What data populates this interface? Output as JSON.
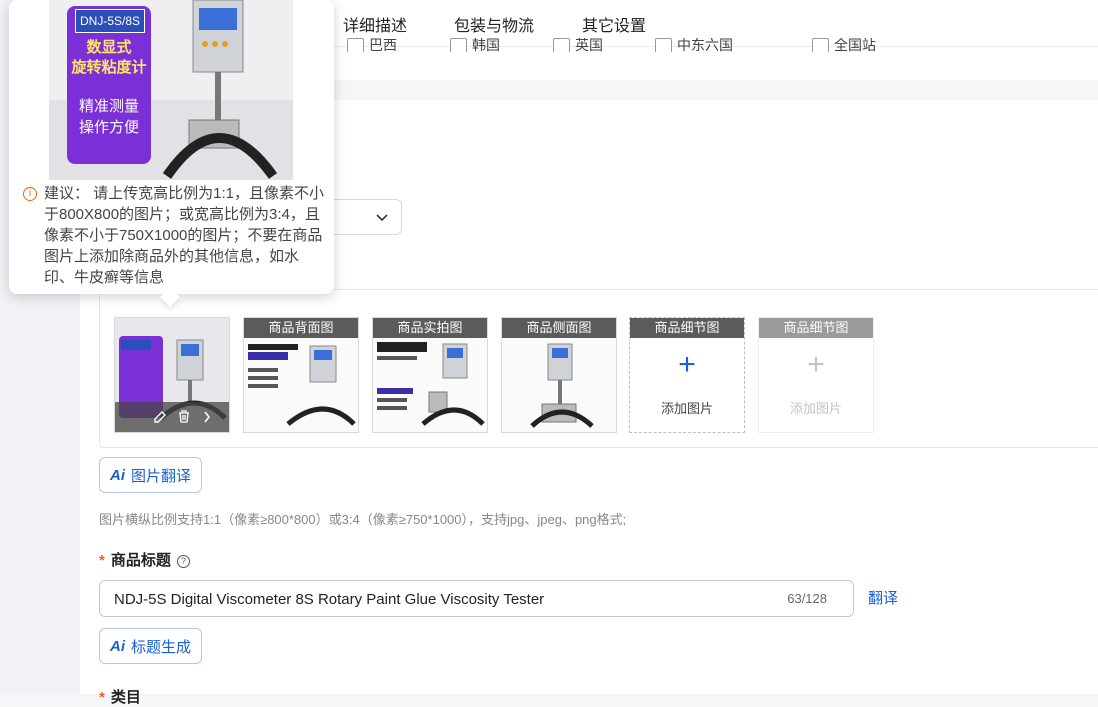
{
  "tabs": [
    {
      "label": "详细描述"
    },
    {
      "label": "包装与物流"
    },
    {
      "label": "其它设置"
    }
  ],
  "checkbox_partial_labels": [
    "巴西",
    "韩国",
    "英国",
    "中东六国",
    "全国站"
  ],
  "tooltip": {
    "image": {
      "model_badge": "DNJ-5S/8S",
      "headline_1": "数显式",
      "headline_2": "旋转粘度计",
      "tagline_1": "精准测量",
      "tagline_2": "操作方便"
    },
    "suggestion": "建议： 请上传宽高比例为1:1，且像素不小于800X800的图片；或宽高比例为3:4，且像素不小于750X1000的图片；不要在商品图片上添加除商品外的其他信息，如水印、牛皮癣等信息"
  },
  "images": [
    {
      "header": "",
      "kind": "main"
    },
    {
      "header": "商品背面图",
      "kind": "image"
    },
    {
      "header": "商品实拍图",
      "kind": "image"
    },
    {
      "header": "商品侧面图",
      "kind": "image"
    },
    {
      "header": "商品细节图",
      "kind": "add",
      "add_label": "添加图片"
    },
    {
      "header": "商品细节图",
      "kind": "add-disabled",
      "add_label": "添加图片"
    }
  ],
  "ai_translate_button": {
    "icon": "Ai",
    "label": "图片翻译"
  },
  "image_hint": "图片横纵比例支持1:1（像素≥800*800）或3:4（像素≥750*1000），支持jpg、jpeg、png格式;",
  "title_field": {
    "label": "商品标题",
    "required_mark": "*",
    "value": "NDJ-5S Digital Viscometer 8S Rotary Paint Glue Viscosity Tester",
    "count": "63/128",
    "translate_label": "翻译"
  },
  "ai_title_button": {
    "icon": "Ai",
    "label": "标题生成"
  },
  "next_field_label": "类目",
  "colors": {
    "accent": "#1a5fd6",
    "required": "#e8651a",
    "product_purple": "#7b2fd6"
  }
}
